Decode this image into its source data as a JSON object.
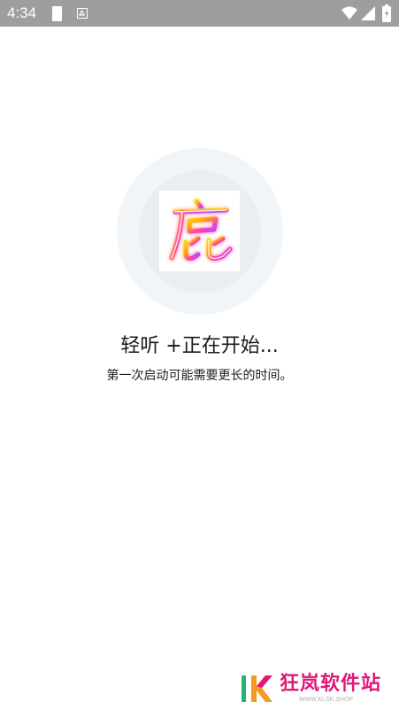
{
  "status_bar": {
    "time": "4:34"
  },
  "app": {
    "logo_name": "deer-character-logo",
    "title": "轻听 +正在开始...",
    "subtitle": "第一次启动可能需要更长的时间。"
  },
  "watermark": {
    "text": "狂岚软件站",
    "url": "WWW.KLSK.SHOP"
  },
  "colors": {
    "status_bar": "#9e9e9e",
    "halo_outer": "#f1f5f8",
    "halo_inner": "#e8eef2",
    "watermark_pink": "#e0187a",
    "watermark_green": "#22b573"
  }
}
